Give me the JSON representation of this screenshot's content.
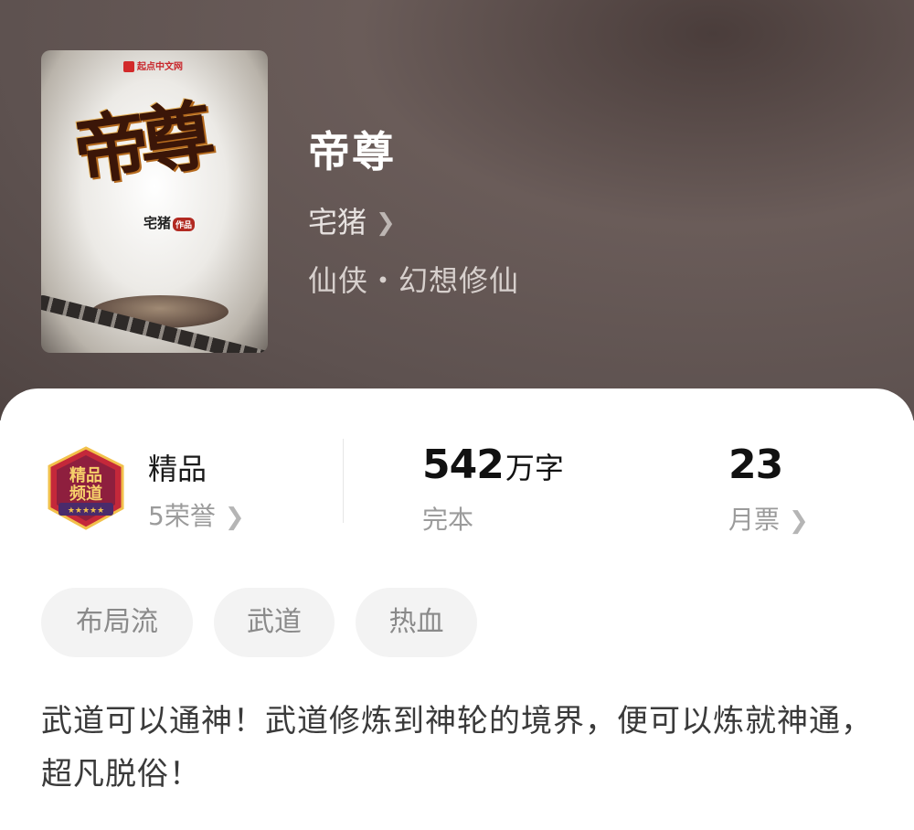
{
  "book": {
    "title": "帝尊",
    "author": "宅猪",
    "category": "仙侠・幻想修仙",
    "cover": {
      "publisher": "起点中文网",
      "title": "帝尊",
      "author": "宅猪",
      "author_tag": "作品"
    }
  },
  "stats": {
    "badge": {
      "line1": "精品",
      "line2": "频道",
      "label": "精品",
      "sub": "5荣誉"
    },
    "words": {
      "number": "542",
      "unit": "万字",
      "sub": "完本"
    },
    "tickets": {
      "number": "23",
      "sub": "月票"
    }
  },
  "tags": [
    "布局流",
    "武道",
    "热血"
  ],
  "description": "武道可以通神！武道修炼到神轮的境界，便可以炼就神通，超凡脱俗！",
  "colors": {
    "header_bg": "#5e5250",
    "badge_red": "#c4283a",
    "badge_purple": "#4a2b6b",
    "badge_gold": "#f2c14b",
    "tag_bg": "#f3f3f3"
  },
  "icons": {
    "chevron": "chevron-right-icon"
  }
}
